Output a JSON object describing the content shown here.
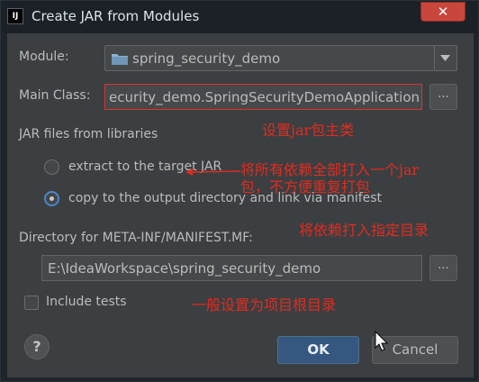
{
  "window": {
    "title": "Create JAR from Modules",
    "icon_text": "IJ",
    "close_symbol": "✕"
  },
  "module": {
    "label": "Module:",
    "value": "spring_security_demo"
  },
  "main_class": {
    "label": "Main Class:",
    "value": "ecurity_demo.SpringSecurityDemoApplication",
    "browse_label": "..."
  },
  "jar_files": {
    "label": "JAR files from libraries",
    "options": [
      {
        "label": "extract to the target JAR",
        "selected": false
      },
      {
        "label": "copy to the output directory and link via manifest",
        "selected": true
      }
    ]
  },
  "manifest": {
    "label": "Directory for META-INF/MANIFEST.MF:",
    "value": "E:\\IdeaWorkspace\\spring_security_demo",
    "browse_label": "..."
  },
  "include_tests": {
    "label": "Include tests",
    "checked": false
  },
  "buttons": {
    "help": "?",
    "ok": "OK",
    "cancel": "Cancel"
  },
  "annotations": {
    "main_class_note": "设置jar包主类",
    "extract_note_line1": "将所有依赖全部打入一个jar",
    "extract_note_line2": "包，不方便重复打包",
    "copy_note": "将依赖打入指定目录",
    "directory_note": "一般设置为项目根目录",
    "color": "#e02b20"
  },
  "colors": {
    "accent": "#365880",
    "panel": "#3c3f41",
    "error_border": "#e03030"
  }
}
